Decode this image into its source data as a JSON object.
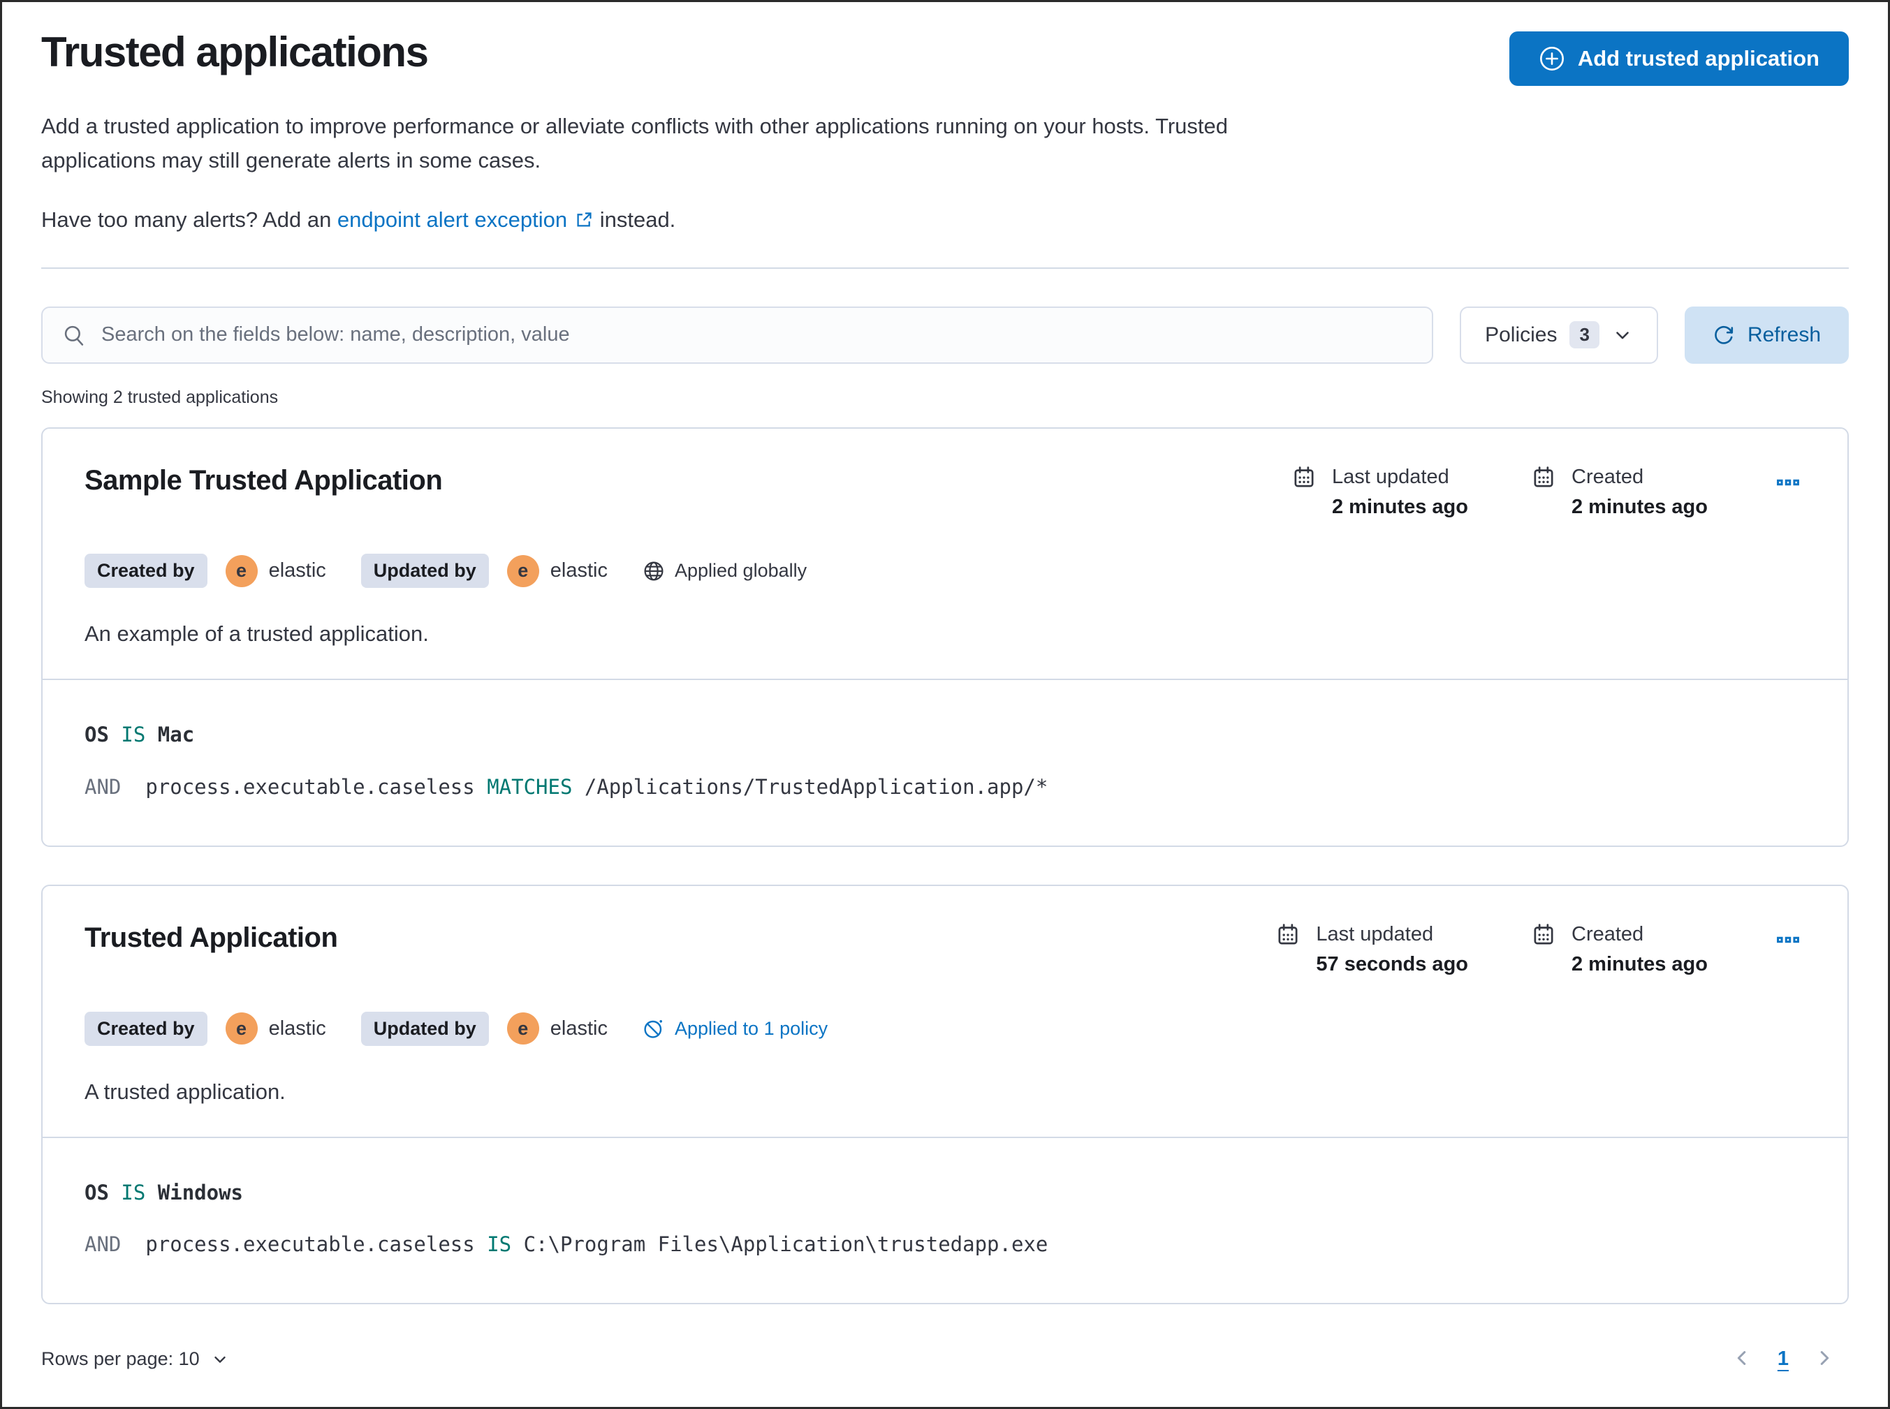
{
  "colors": {
    "primary_blue": "#0b74c4",
    "refresh_button_bg": "#cfe2f4",
    "operator_teal": "#007871",
    "conjunction_gray": "#69707d",
    "avatar_orange": "#f3a05c",
    "badge_bg": "#d9dfec",
    "border_gray": "#d3dae6"
  },
  "page": {
    "title": "Trusted applications",
    "description": "Add a trusted application to improve performance or alleviate conflicts with other applications running on your hosts. Trusted applications may still generate alerts in some cases.",
    "alerts_prompt_prefix": "Have too many alerts? Add an ",
    "alerts_link_label": "endpoint alert exception",
    "alerts_prompt_suffix": " instead."
  },
  "header": {
    "add_button_label": "Add trusted application"
  },
  "toolbar": {
    "search_placeholder": "Search on the fields below: name, description, value",
    "policies_label": "Policies",
    "policies_count": "3",
    "refresh_label": "Refresh"
  },
  "summary_text": "Showing 2 trusted applications",
  "cards": [
    {
      "title": "Sample Trusted Application",
      "created_by_label": "Created by",
      "created_by_user": "elastic",
      "updated_by_label": "Updated by",
      "updated_by_user": "elastic",
      "avatar_initial": "e",
      "scope_label": "Applied globally",
      "meta": {
        "last_updated_label": "Last updated",
        "last_updated_value": "2 minutes ago",
        "created_label": "Created",
        "created_value": "2 minutes ago"
      },
      "description": "An example of a trusted application.",
      "condition_line1": {
        "field": "OS",
        "operator": "IS",
        "value": "Mac"
      },
      "condition_line2": {
        "conjunction": "AND",
        "field": "process.executable.caseless",
        "operator": "MATCHES",
        "value": "/Applications/TrustedApplication.app/*"
      }
    },
    {
      "title": "Trusted Application",
      "created_by_label": "Created by",
      "created_by_user": "elastic",
      "updated_by_label": "Updated by",
      "updated_by_user": "elastic",
      "avatar_initial": "e",
      "scope_label": "Applied to 1 policy",
      "meta": {
        "last_updated_label": "Last updated",
        "last_updated_value": "57 seconds ago",
        "created_label": "Created",
        "created_value": "2 minutes ago"
      },
      "description": "A trusted application.",
      "condition_line1": {
        "field": "OS",
        "operator": "IS",
        "value": "Windows"
      },
      "condition_line2": {
        "conjunction": "AND",
        "field": "process.executable.caseless",
        "operator": "IS",
        "value": "C:\\Program Files\\Application\\trustedapp.exe"
      }
    }
  ],
  "footer": {
    "rows_per_page_label": "Rows per page: 10",
    "page_number": "1"
  }
}
